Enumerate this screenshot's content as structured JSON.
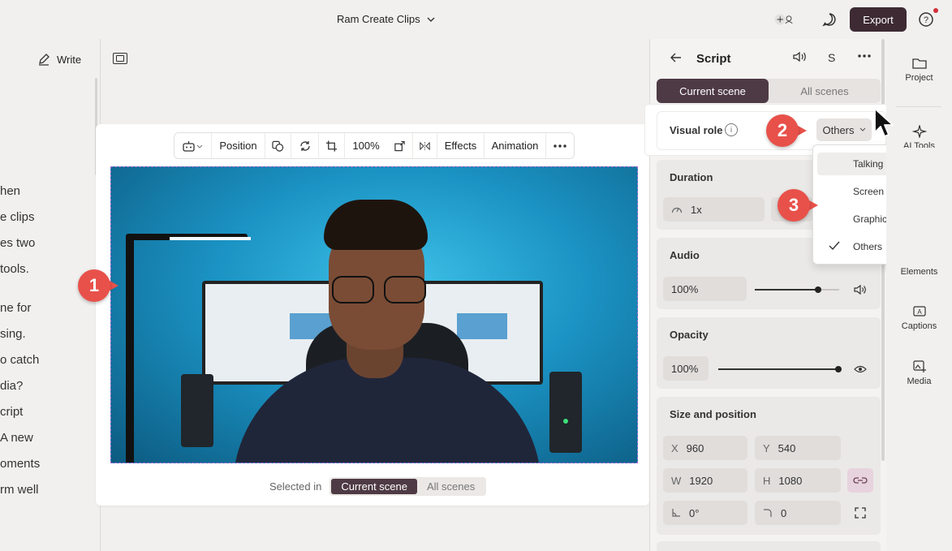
{
  "topbar": {
    "title": "Ram Create Clips",
    "export_label": "Export"
  },
  "left": {
    "write_label": "Write",
    "script_lines": [
      "hen",
      "e clips",
      "es two",
      "tools.",
      "ne for",
      "sing.",
      "o catch",
      "dia?",
      "cript",
      "A new",
      "oments",
      "rm well"
    ]
  },
  "toolbar": {
    "position_label": "Position",
    "zoom_label": "100%",
    "effects_label": "Effects",
    "animation_label": "Animation"
  },
  "canvas": {
    "selected_in_label": "Selected in",
    "scope_tabs": [
      "Current scene",
      "All scenes"
    ],
    "active_scope": "Current scene"
  },
  "script_panel": {
    "title": "Script",
    "s_label": "S",
    "scope_tabs": [
      "Current scene",
      "All scenes"
    ],
    "visual_role_label": "Visual role",
    "visual_role_value": "Others",
    "dropdown_options": [
      "Talking head",
      "Screen recording",
      "Graphics",
      "Others"
    ],
    "selected_option": "Others",
    "duration": {
      "title": "Duration",
      "speed": "1x"
    },
    "audio": {
      "title": "Audio",
      "volume": "100%",
      "level": 0.75
    },
    "opacity": {
      "title": "Opacity",
      "value": "100%",
      "level": 1.0
    },
    "size_position": {
      "title": "Size and position",
      "x_label": "X",
      "x": "960",
      "y_label": "Y",
      "y": "540",
      "w_label": "W",
      "w": "1920",
      "h_label": "H",
      "h": "1080",
      "rotation": "0°",
      "corner": "0"
    }
  },
  "rail": {
    "items": [
      "Project",
      "AI Tools",
      "Elements",
      "Captions",
      "Media"
    ]
  },
  "callouts": [
    "1",
    "2",
    "3"
  ],
  "colors": {
    "accent": "#4e3a44",
    "export_bg": "#3d2a33",
    "callout": "#e8514a"
  }
}
